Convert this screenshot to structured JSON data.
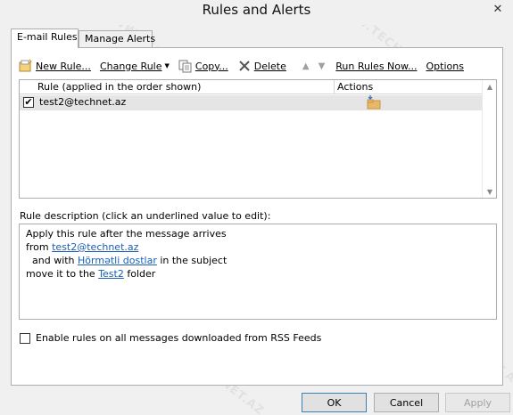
{
  "window": {
    "title": "Rules and Alerts",
    "close_glyph": "✕"
  },
  "tabs": [
    {
      "label": "E-mail Rules",
      "active": true
    },
    {
      "label": "Manage Alerts",
      "active": false
    }
  ],
  "toolbar": {
    "new_rule": "New Rule...",
    "change_rule": "Change Rule",
    "copy": "Copy...",
    "delete": "Delete",
    "run_rules_now": "Run Rules Now...",
    "options": "Options"
  },
  "rules_list": {
    "columns": [
      "Rule (applied in the order shown)",
      "Actions"
    ],
    "rows": [
      {
        "name": "test2@technet.az",
        "enabled": true,
        "action_icon": "move-to-folder-icon"
      }
    ]
  },
  "description": {
    "label": "Rule description (click an underlined value to edit):",
    "line1": "Apply this rule after the message arrives",
    "line2_prefix": "from ",
    "line2_link": "test2@technet.az",
    "line3_prefix": "and with ",
    "line3_link": "Hörmətli dostlar",
    "line3_suffix": " in the subject",
    "line4_prefix": "move it to the ",
    "line4_link": "Test2",
    "line4_suffix": " folder"
  },
  "rss_option": {
    "label": "Enable rules on all messages downloaded from RSS Feeds",
    "checked": false
  },
  "buttons": {
    "ok": "OK",
    "cancel": "Cancel",
    "apply": "Apply"
  },
  "watermark_text": "WWW.TECHNET.AZ",
  "colors": {
    "link": "#1a5fb4",
    "selection": "#e5e5e5",
    "folder": "#e8b86a",
    "delete_x": "#555555"
  }
}
